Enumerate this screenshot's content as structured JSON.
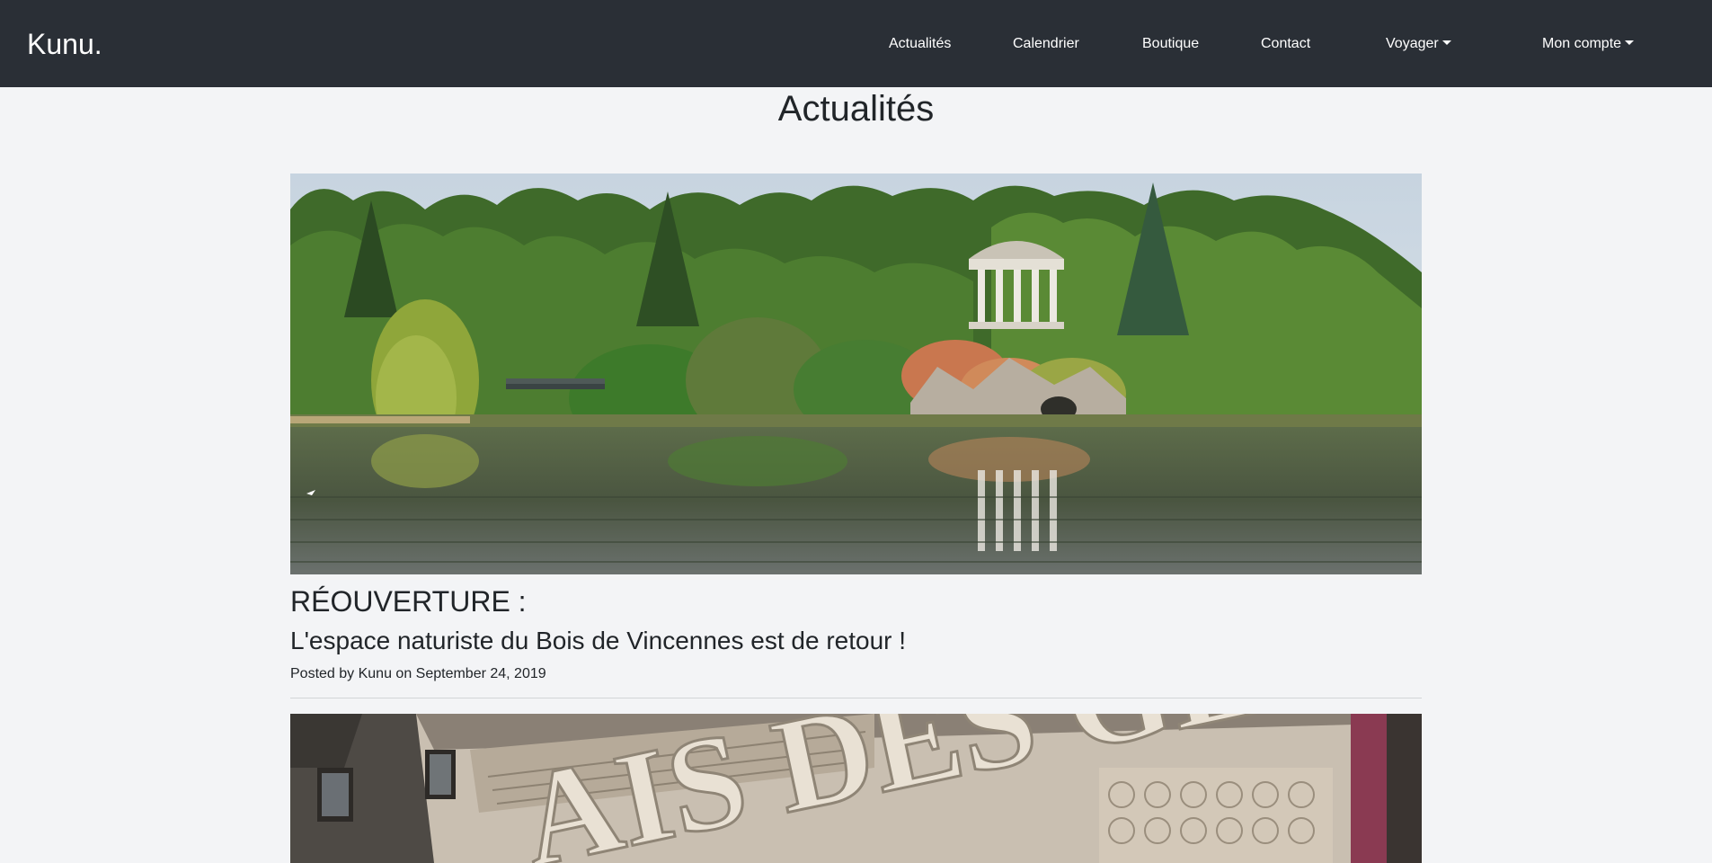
{
  "navbar": {
    "brand": "Kunu.",
    "links": {
      "actualites": "Actualités",
      "calendrier": "Calendrier",
      "boutique": "Boutique",
      "contact": "Contact",
      "voyager": "Voyager",
      "mon_compte": "Mon compte"
    },
    "background_color": "#2a2f36"
  },
  "main": {
    "page_title": "Actualités",
    "posts": [
      {
        "title": "RÉOUVERTURE :",
        "subtitle": "L'espace naturiste du Bois de Vincennes est de retour !",
        "meta": "Posted by Kunu on September 24, 2019",
        "image": "lake-temple-park-photo"
      },
      {
        "image": "palais-des-glaces-facade-photo",
        "image_text": "AIS DES GLACE"
      }
    ]
  }
}
